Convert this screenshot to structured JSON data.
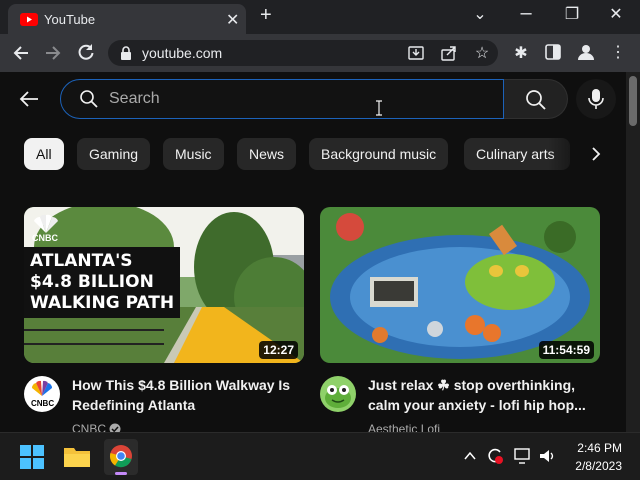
{
  "browser": {
    "tab_title": "YouTube",
    "tab_close": "✕",
    "new_tab": "+",
    "url": "youtube.com",
    "window_buttons": {
      "dropdown": "⌄",
      "restore": "❐",
      "close": "✕"
    }
  },
  "youtube": {
    "search": {
      "placeholder": "Search",
      "value": ""
    },
    "chips": [
      {
        "label": "All",
        "active": true
      },
      {
        "label": "Gaming"
      },
      {
        "label": "Music"
      },
      {
        "label": "News"
      },
      {
        "label": "Background music"
      },
      {
        "label": "Culinary arts"
      }
    ],
    "videos": [
      {
        "thumbnail_text": "ATLANTA'S\n$4.8 BILLION\nWALKING PATH",
        "logo_text": "CNBC",
        "duration": "12:27",
        "title": "How This $4.8 Billion Walkway Is Redefining Atlanta",
        "channel": "CNBC",
        "verified": true
      },
      {
        "duration": "11:54:59",
        "title": "Just relax ☘ stop overthinking, calm your anxiety - lofi hip hop...",
        "channel": "Aesthetic Lofi"
      }
    ]
  },
  "taskbar": {
    "time": "2:46 PM",
    "date": "2/8/2023"
  },
  "colors": {
    "accent_blue": "#1c62b9",
    "yt_red": "#ff0000",
    "background": "#0f0f0f"
  }
}
